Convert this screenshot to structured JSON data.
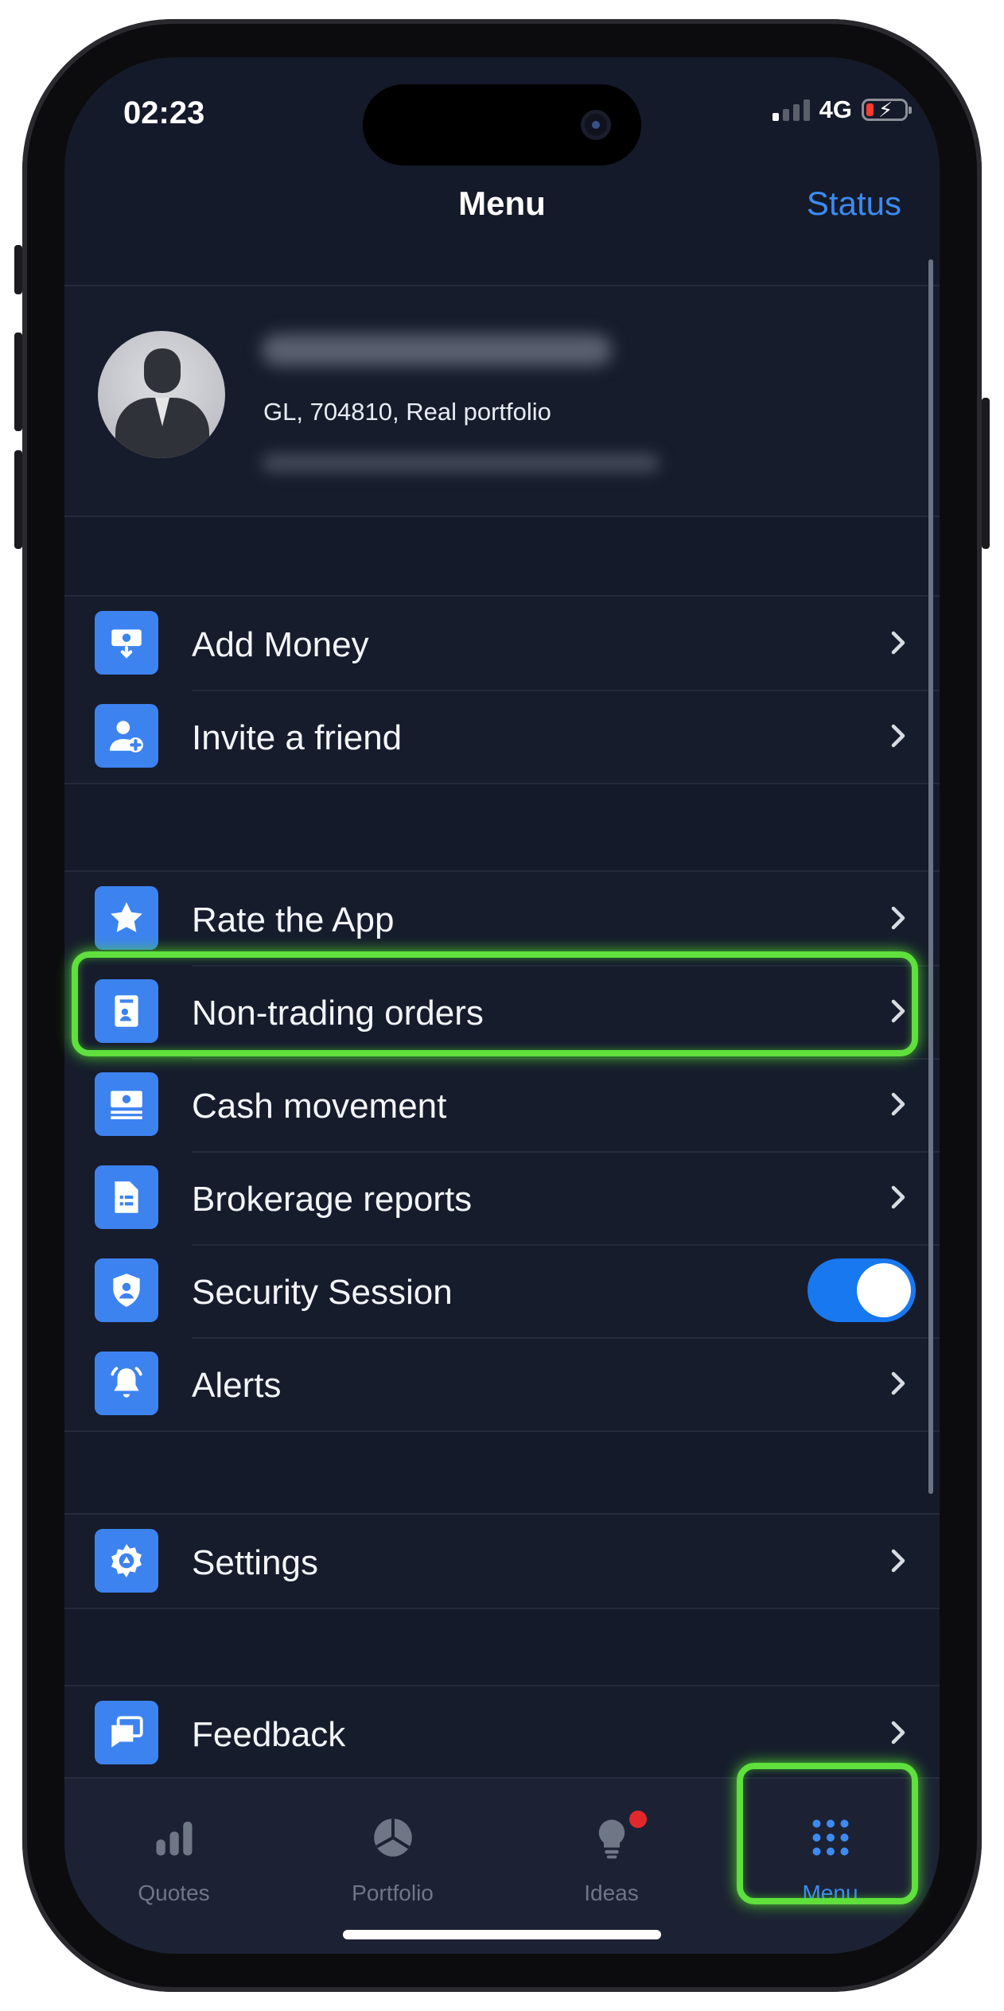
{
  "status_bar": {
    "time": "02:23",
    "network": "4G"
  },
  "nav": {
    "title": "Menu",
    "status": "Status"
  },
  "profile": {
    "account": "GL, 704810, Real portfolio"
  },
  "groups": {
    "money": [
      {
        "label": "Add Money",
        "icon": "add-money-icon"
      },
      {
        "label": "Invite a friend",
        "icon": "invite-friend-icon"
      }
    ],
    "main": [
      {
        "label": "Rate the App",
        "icon": "star-icon"
      },
      {
        "label": "Non-trading orders",
        "icon": "order-document-icon"
      },
      {
        "label": "Cash movement",
        "icon": "cash-icon"
      },
      {
        "label": "Brokerage reports",
        "icon": "report-document-icon"
      },
      {
        "label": "Security Session",
        "icon": "shield-user-icon",
        "toggle": true
      },
      {
        "label": "Alerts",
        "icon": "bell-icon"
      }
    ],
    "settings": [
      {
        "label": "Settings",
        "icon": "gear-icon"
      }
    ],
    "feedback": [
      {
        "label": "Feedback",
        "icon": "chat-icon"
      }
    ]
  },
  "tabs": [
    {
      "label": "Quotes",
      "icon": "bar-chart-icon"
    },
    {
      "label": "Portfolio",
      "icon": "pie-chart-icon"
    },
    {
      "label": "Ideas",
      "icon": "lightbulb-icon",
      "badge": true
    },
    {
      "label": "Menu",
      "icon": "grid-dots-icon",
      "active": true
    }
  ],
  "colors": {
    "accent": "#3d8bf2",
    "background": "#141a29",
    "row": "#161c2c",
    "highlight": "#5fe03d",
    "badge": "#e3282d"
  }
}
